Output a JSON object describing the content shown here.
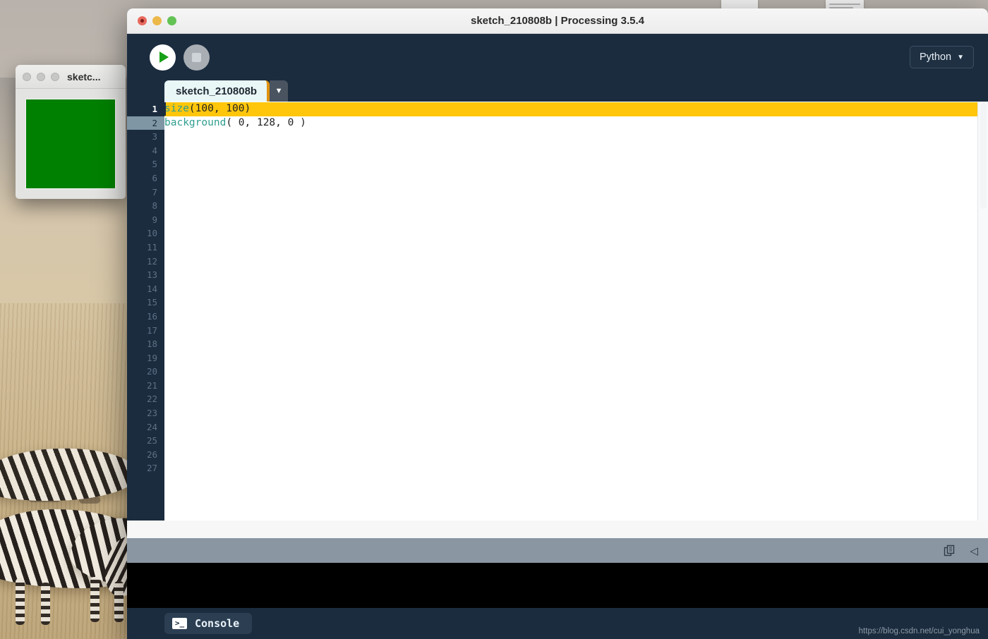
{
  "desktop": {
    "wallpaper_description": "zebras grazing on savanna",
    "watermark": "https://blog.csdn.net/cui_yonghua"
  },
  "sketch_window": {
    "title": "sketc...",
    "canvas_color": "#008000",
    "traffic_lights": [
      "inactive-close",
      "inactive-minimize",
      "inactive-zoom"
    ]
  },
  "pde": {
    "title": "sketch_210808b | Processing 3.5.4",
    "traffic_lights": [
      "close",
      "minimize",
      "zoom"
    ],
    "toolbar": {
      "run_label": "run-icon",
      "stop_label": "stop-icon",
      "mode": "Python",
      "mode_caret": "▼"
    },
    "tab": {
      "name": "sketch_210808b",
      "menu_caret": "▼"
    },
    "editor": {
      "line_numbers": [
        "1",
        "2",
        "3",
        "4",
        "5",
        "6",
        "7",
        "8",
        "9",
        "10",
        "11",
        "12",
        "13",
        "14",
        "15",
        "16",
        "17",
        "18",
        "19",
        "20",
        "21",
        "22",
        "23",
        "24",
        "25",
        "26",
        "27"
      ],
      "current_line": 1,
      "highlighted_line": 2,
      "lines": [
        {
          "n": 1,
          "fn": "size",
          "rest": "(100, 100)",
          "highlight": "full"
        },
        {
          "n": 2,
          "fn": "background",
          "rest": "( 0, 128, 0 )",
          "highlight": "fit"
        }
      ],
      "selection_color": "#ffc60b",
      "function_color": "#2f9e8f"
    },
    "statusbar": {
      "copy_icon": "copy-icon",
      "collapse_icon": "◁"
    },
    "console": {
      "button_label": "Console",
      "button_icon": ">_",
      "output": ""
    }
  }
}
